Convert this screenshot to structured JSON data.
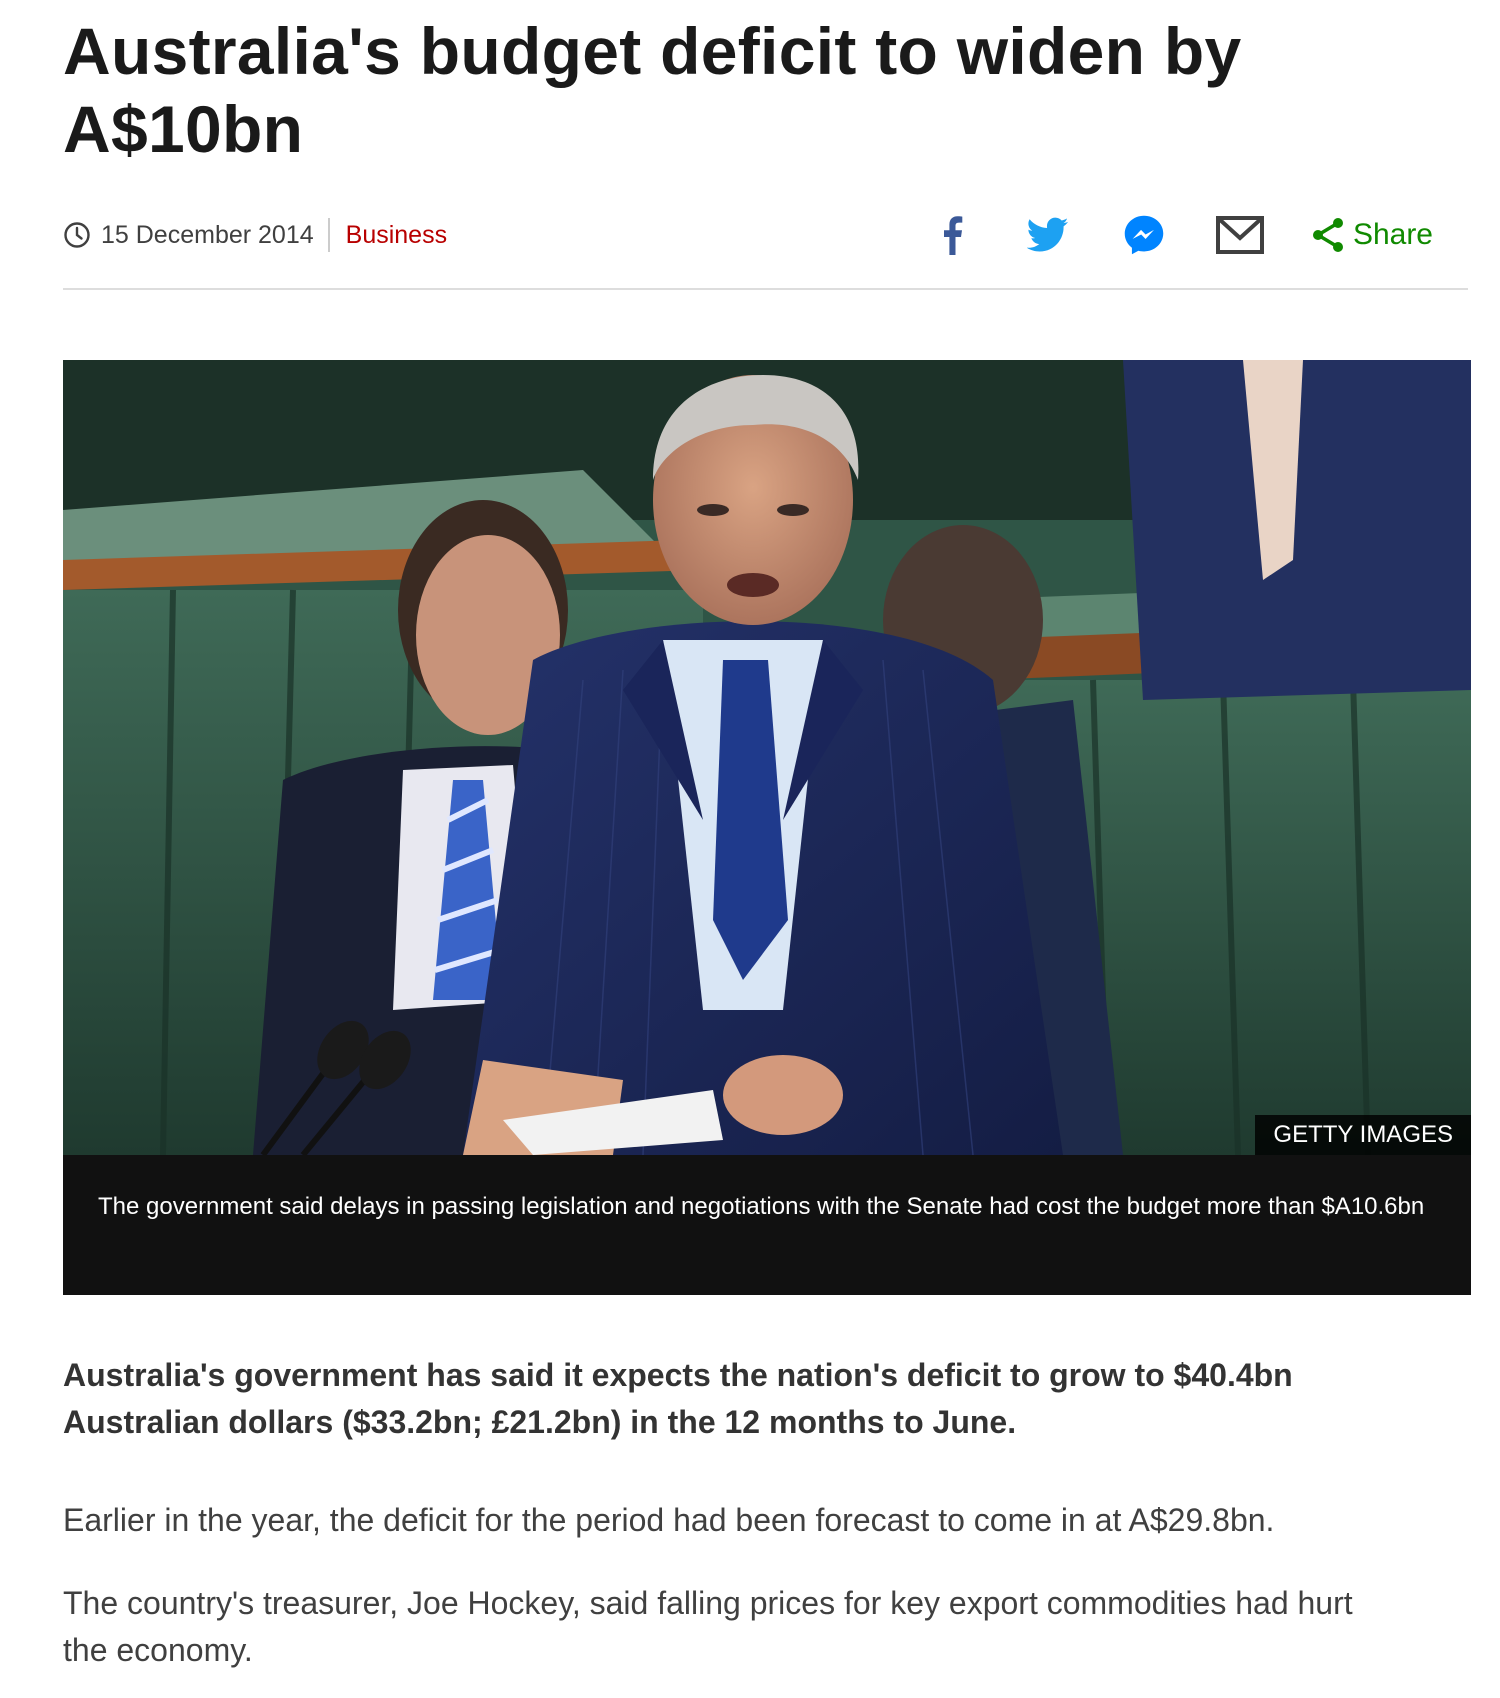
{
  "article": {
    "headline": "Australia's budget deficit to widen by A$10bn",
    "date": "15 December 2014",
    "section": "Business",
    "share_label": "Share",
    "image": {
      "alt": "Treasurer speaking in parliament",
      "credit": "GETTY IMAGES",
      "caption": "The government said delays in passing legislation and negotiations with the Senate had cost the budget more than $A10.6bn"
    },
    "lead": "Australia's government has said it expects the nation's deficit to grow to $40.4bn Australian dollars ($33.2bn; £21.2bn) in the 12 months to June.",
    "paragraphs": [
      "Earlier in the year, the deficit for the period had been forecast to come in at A$29.8bn.",
      "The country's treasurer, Joe Hockey, said falling prices for key export commodities had hurt the economy."
    ]
  },
  "icons": {
    "clock": "clock-icon",
    "facebook": "facebook-icon",
    "twitter": "twitter-icon",
    "messenger": "messenger-icon",
    "email": "email-icon",
    "share": "share-icon"
  },
  "colors": {
    "section": "#b80000",
    "share": "#108a00",
    "facebook": "#3b5998",
    "twitter": "#1da1f2",
    "messenger": "#0084ff",
    "email": "#404040"
  }
}
